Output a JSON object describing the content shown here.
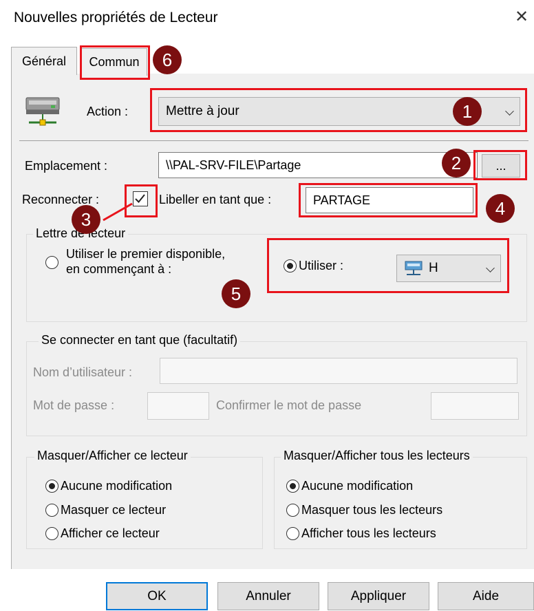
{
  "window": {
    "title": "Nouvelles propriétés de Lecteur",
    "close_glyph": "✕"
  },
  "tabs": [
    {
      "label": "Général"
    },
    {
      "label": "Commun"
    }
  ],
  "badges": [
    "1",
    "2",
    "3",
    "4",
    "5",
    "6"
  ],
  "action": {
    "label": "Action :",
    "value": "Mettre à jour"
  },
  "emplacement": {
    "label": "Emplacement :",
    "value": "\\\\PAL-SRV-FILE\\Partage",
    "browse_label": "..."
  },
  "reconnecter": {
    "label": "Reconnecter :",
    "checked": true,
    "libeller_label": "Libeller en tant que :",
    "libeller_value": "PARTAGE"
  },
  "lettre": {
    "legend": "Lettre de lecteur",
    "option_first_line1": "Utiliser le premier disponible,",
    "option_first_line2": "en commençant à :",
    "option_use": "Utiliser :",
    "drive_value": "H"
  },
  "connect_as": {
    "legend": "Se connecter en tant que (facultatif)",
    "user_label": "Nom d’utilisateur :",
    "password_label": "Mot de passe :",
    "confirm_label": "Confirmer le mot de passe"
  },
  "hide_this": {
    "legend": "Masquer/Afficher ce lecteur",
    "options": [
      "Aucune modification",
      "Masquer ce lecteur",
      "Afficher ce lecteur"
    ]
  },
  "hide_all": {
    "legend": "Masquer/Afficher tous les lecteurs",
    "options": [
      "Aucune modification",
      "Masquer tous les lecteurs",
      "Afficher tous les lecteurs"
    ]
  },
  "buttons": {
    "ok": "OK",
    "cancel": "Annuler",
    "apply": "Appliquer",
    "help": "Aide"
  },
  "colors": {
    "highlight": "#e8141c",
    "badge": "#7b0f10",
    "panel": "#f0f0f0"
  }
}
